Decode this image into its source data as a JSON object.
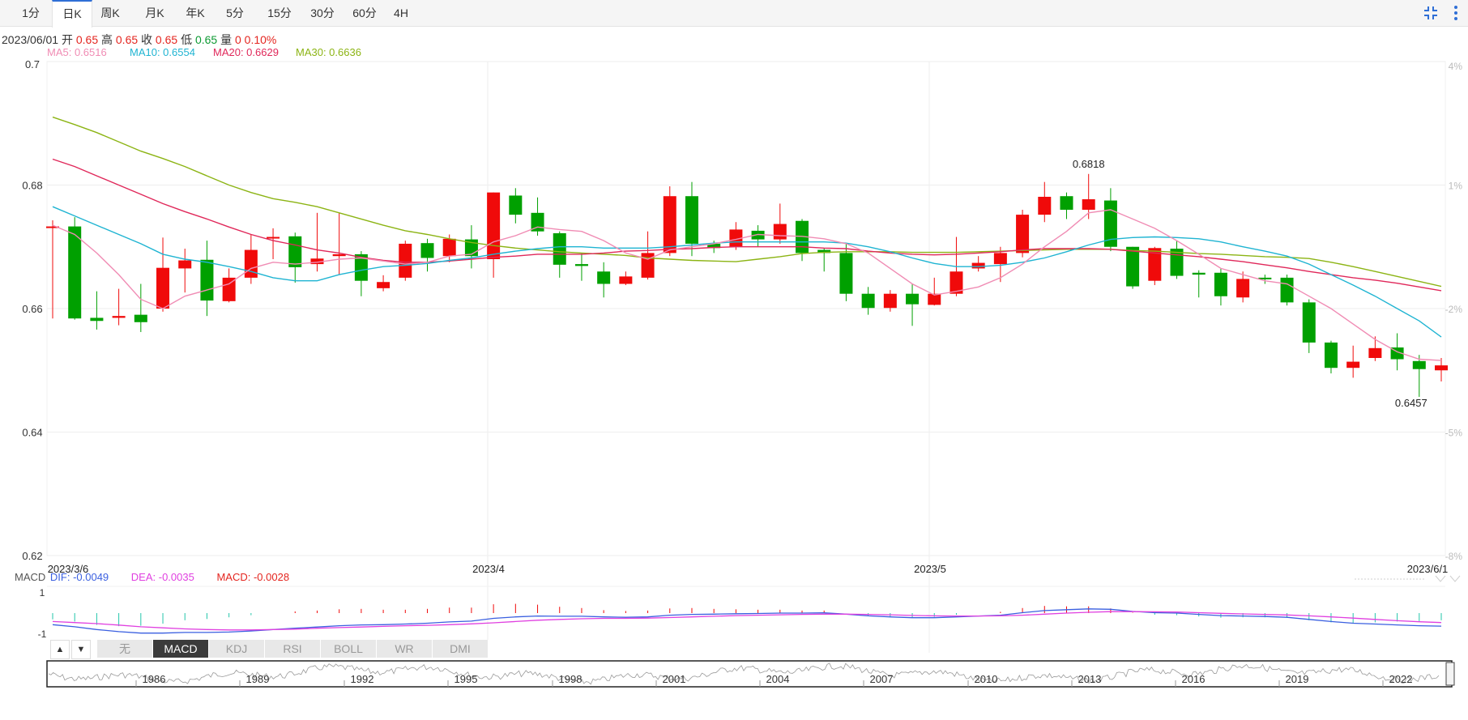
{
  "toolbar": {
    "tabs": [
      "1分",
      "日K",
      "周K",
      "月K",
      "年K",
      "5分",
      "15分",
      "30分",
      "60分",
      "4H"
    ],
    "active_tab": "日K",
    "icons": [
      "fullscreen-exit-icon",
      "more-menu-icon"
    ]
  },
  "ohlc_info": {
    "date": "2023/06/01",
    "open_label": "开",
    "open": "0.65",
    "high_label": "高",
    "high": "0.65",
    "close_label": "收",
    "close": "0.65",
    "low_label": "低",
    "low": "0.65",
    "volume_label": "量",
    "volume": "0",
    "change": "0.10%"
  },
  "ma_info": [
    {
      "label": "MA5: 0.6516",
      "color": "#f08cb4"
    },
    {
      "label": "MA10: 0.6554",
      "color": "#1fb4d2"
    },
    {
      "label": "MA20: 0.6629",
      "color": "#e0285a"
    },
    {
      "label": "MA30: 0.6636",
      "color": "#8cb414"
    }
  ],
  "macd_info": {
    "name": "MACD",
    "dif": {
      "label": "DIF: -0.0049",
      "color": "#3a5fe0"
    },
    "dea": {
      "label": "DEA: -0.0035",
      "color": "#e040e0"
    },
    "macd": {
      "label": "MACD: -0.0028",
      "color": "#e4251f"
    }
  },
  "indicator_tabs": [
    "无",
    "MACD",
    "KDJ",
    "RSI",
    "BOLL",
    "WR",
    "DMI"
  ],
  "active_indicator": "MACD",
  "indicator_arrows": [
    "▲",
    "▼"
  ],
  "colors": {
    "up": "#f00a0a",
    "down": "#00a000",
    "grid": "#eeeeee",
    "axis_text": "#333333",
    "pct_text": "#bbbbbb"
  },
  "chart_data": {
    "type": "candlestick",
    "y_ticks": [
      "0.7",
      "0.68",
      "0.66",
      "0.64",
      "0.62"
    ],
    "ylim": [
      0.62,
      0.7
    ],
    "pct_ticks": [
      "4%",
      "1%",
      "-2%",
      "-5%",
      "-8%"
    ],
    "x_labels": [
      "2023/3/6",
      "2023/4",
      "2023/5",
      "2023/6/1"
    ],
    "high_label": "0.6818",
    "low_label": "0.6457",
    "candles": [
      {
        "o": 0.6733,
        "h": 0.6743,
        "l": 0.6584,
        "c": 0.6733
      },
      {
        "o": 0.6733,
        "h": 0.6748,
        "l": 0.6582,
        "c": 0.6584
      },
      {
        "o": 0.6585,
        "h": 0.6628,
        "l": 0.6566,
        "c": 0.658
      },
      {
        "o": 0.6585,
        "h": 0.6632,
        "l": 0.6573,
        "c": 0.6588
      },
      {
        "o": 0.659,
        "h": 0.664,
        "l": 0.6562,
        "c": 0.6578
      },
      {
        "o": 0.66,
        "h": 0.6715,
        "l": 0.6595,
        "c": 0.6666
      },
      {
        "o": 0.6665,
        "h": 0.6697,
        "l": 0.6626,
        "c": 0.6678
      },
      {
        "o": 0.6679,
        "h": 0.671,
        "l": 0.6588,
        "c": 0.6613
      },
      {
        "o": 0.6612,
        "h": 0.6665,
        "l": 0.661,
        "c": 0.665
      },
      {
        "o": 0.665,
        "h": 0.672,
        "l": 0.664,
        "c": 0.6695
      },
      {
        "o": 0.6715,
        "h": 0.673,
        "l": 0.668,
        "c": 0.6716
      },
      {
        "o": 0.6717,
        "h": 0.6723,
        "l": 0.6642,
        "c": 0.6667
      },
      {
        "o": 0.6672,
        "h": 0.6755,
        "l": 0.666,
        "c": 0.6681
      },
      {
        "o": 0.6685,
        "h": 0.6755,
        "l": 0.6655,
        "c": 0.6688
      },
      {
        "o": 0.6688,
        "h": 0.6693,
        "l": 0.662,
        "c": 0.6645
      },
      {
        "o": 0.6633,
        "h": 0.6654,
        "l": 0.6628,
        "c": 0.6643
      },
      {
        "o": 0.665,
        "h": 0.671,
        "l": 0.6645,
        "c": 0.6705
      },
      {
        "o": 0.6706,
        "h": 0.6713,
        "l": 0.666,
        "c": 0.6682
      },
      {
        "o": 0.6685,
        "h": 0.672,
        "l": 0.6675,
        "c": 0.6713
      },
      {
        "o": 0.6712,
        "h": 0.6735,
        "l": 0.6665,
        "c": 0.6685
      },
      {
        "o": 0.668,
        "h": 0.6788,
        "l": 0.665,
        "c": 0.6788
      },
      {
        "o": 0.6783,
        "h": 0.6795,
        "l": 0.6738,
        "c": 0.6752
      },
      {
        "o": 0.6755,
        "h": 0.678,
        "l": 0.6718,
        "c": 0.6725
      },
      {
        "o": 0.6722,
        "h": 0.6725,
        "l": 0.665,
        "c": 0.6671
      },
      {
        "o": 0.6672,
        "h": 0.669,
        "l": 0.6645,
        "c": 0.6669
      },
      {
        "o": 0.666,
        "h": 0.6675,
        "l": 0.6618,
        "c": 0.664
      },
      {
        "o": 0.664,
        "h": 0.666,
        "l": 0.6638,
        "c": 0.6652
      },
      {
        "o": 0.665,
        "h": 0.6725,
        "l": 0.6647,
        "c": 0.669
      },
      {
        "o": 0.669,
        "h": 0.6798,
        "l": 0.6685,
        "c": 0.6782
      },
      {
        "o": 0.6782,
        "h": 0.6805,
        "l": 0.6685,
        "c": 0.6705
      },
      {
        "o": 0.6705,
        "h": 0.671,
        "l": 0.669,
        "c": 0.6698
      },
      {
        "o": 0.67,
        "h": 0.674,
        "l": 0.6695,
        "c": 0.6728
      },
      {
        "o": 0.6726,
        "h": 0.6735,
        "l": 0.67,
        "c": 0.6712
      },
      {
        "o": 0.6712,
        "h": 0.677,
        "l": 0.6705,
        "c": 0.6737
      },
      {
        "o": 0.6742,
        "h": 0.6745,
        "l": 0.6677,
        "c": 0.669
      },
      {
        "o": 0.6695,
        "h": 0.6698,
        "l": 0.666,
        "c": 0.669
      },
      {
        "o": 0.669,
        "h": 0.6705,
        "l": 0.6612,
        "c": 0.6624
      },
      {
        "o": 0.6624,
        "h": 0.6635,
        "l": 0.659,
        "c": 0.6601
      },
      {
        "o": 0.6601,
        "h": 0.663,
        "l": 0.6595,
        "c": 0.6624
      },
      {
        "o": 0.6624,
        "h": 0.664,
        "l": 0.6572,
        "c": 0.6607
      },
      {
        "o": 0.6606,
        "h": 0.665,
        "l": 0.6605,
        "c": 0.6624
      },
      {
        "o": 0.6624,
        "h": 0.6716,
        "l": 0.662,
        "c": 0.666
      },
      {
        "o": 0.6665,
        "h": 0.6685,
        "l": 0.666,
        "c": 0.6674
      },
      {
        "o": 0.6672,
        "h": 0.67,
        "l": 0.6643,
        "c": 0.669
      },
      {
        "o": 0.669,
        "h": 0.676,
        "l": 0.6683,
        "c": 0.6752
      },
      {
        "o": 0.6752,
        "h": 0.6805,
        "l": 0.674,
        "c": 0.6781
      },
      {
        "o": 0.6782,
        "h": 0.6788,
        "l": 0.6745,
        "c": 0.676
      },
      {
        "o": 0.676,
        "h": 0.6818,
        "l": 0.6745,
        "c": 0.6777
      },
      {
        "o": 0.6775,
        "h": 0.6795,
        "l": 0.6693,
        "c": 0.67
      },
      {
        "o": 0.67,
        "h": 0.67,
        "l": 0.6632,
        "c": 0.6636
      },
      {
        "o": 0.6645,
        "h": 0.67,
        "l": 0.6638,
        "c": 0.6698
      },
      {
        "o": 0.6697,
        "h": 0.671,
        "l": 0.6648,
        "c": 0.6653
      },
      {
        "o": 0.6658,
        "h": 0.6662,
        "l": 0.6618,
        "c": 0.6655
      },
      {
        "o": 0.6658,
        "h": 0.6665,
        "l": 0.6605,
        "c": 0.662
      },
      {
        "o": 0.6618,
        "h": 0.666,
        "l": 0.661,
        "c": 0.6648
      },
      {
        "o": 0.665,
        "h": 0.6655,
        "l": 0.664,
        "c": 0.6648
      },
      {
        "o": 0.665,
        "h": 0.6655,
        "l": 0.6605,
        "c": 0.661
      },
      {
        "o": 0.661,
        "h": 0.6615,
        "l": 0.6528,
        "c": 0.6545
      },
      {
        "o": 0.6545,
        "h": 0.6548,
        "l": 0.6495,
        "c": 0.6504
      },
      {
        "o": 0.6504,
        "h": 0.654,
        "l": 0.6488,
        "c": 0.6514
      },
      {
        "o": 0.652,
        "h": 0.6555,
        "l": 0.6515,
        "c": 0.6536
      },
      {
        "o": 0.6537,
        "h": 0.656,
        "l": 0.65,
        "c": 0.6518
      },
      {
        "o": 0.6515,
        "h": 0.6525,
        "l": 0.6457,
        "c": 0.6502
      },
      {
        "o": 0.65,
        "h": 0.652,
        "l": 0.6482,
        "c": 0.6508
      }
    ],
    "ma5": [
      0.6735,
      0.672,
      0.669,
      0.6655,
      0.6615,
      0.66,
      0.662,
      0.663,
      0.664,
      0.6665,
      0.6675,
      0.6672,
      0.6675,
      0.668,
      0.6682,
      0.6677,
      0.6672,
      0.6675,
      0.6685,
      0.6688,
      0.6708,
      0.6718,
      0.6732,
      0.6728,
      0.6725,
      0.671,
      0.669,
      0.668,
      0.6695,
      0.67,
      0.6705,
      0.6712,
      0.672,
      0.6718,
      0.6717,
      0.6713,
      0.6705,
      0.669,
      0.6665,
      0.664,
      0.6622,
      0.6628,
      0.6635,
      0.665,
      0.6672,
      0.67,
      0.6725,
      0.6755,
      0.676,
      0.6745,
      0.673,
      0.671,
      0.6688,
      0.6665,
      0.6655,
      0.6645,
      0.664,
      0.662,
      0.66,
      0.6575,
      0.655,
      0.653,
      0.6518,
      0.6516
    ],
    "ma10": [
      0.6765,
      0.675,
      0.6735,
      0.672,
      0.6705,
      0.6688,
      0.668,
      0.6675,
      0.6668,
      0.666,
      0.665,
      0.6645,
      0.6645,
      0.6655,
      0.6662,
      0.6668,
      0.667,
      0.6673,
      0.6678,
      0.6682,
      0.6688,
      0.6693,
      0.6697,
      0.67,
      0.67,
      0.6698,
      0.6698,
      0.6698,
      0.67,
      0.6703,
      0.6706,
      0.6708,
      0.6708,
      0.6708,
      0.6708,
      0.6708,
      0.6706,
      0.67,
      0.6692,
      0.6682,
      0.6673,
      0.6668,
      0.6668,
      0.667,
      0.6675,
      0.6682,
      0.6692,
      0.6703,
      0.6712,
      0.6715,
      0.6716,
      0.6715,
      0.6713,
      0.6708,
      0.67,
      0.6693,
      0.6685,
      0.6672,
      0.6655,
      0.6638,
      0.662,
      0.66,
      0.658,
      0.6554
    ],
    "ma20": [
      0.6842,
      0.683,
      0.6815,
      0.68,
      0.6785,
      0.677,
      0.6757,
      0.6745,
      0.6732,
      0.672,
      0.671,
      0.6703,
      0.6695,
      0.669,
      0.6683,
      0.6678,
      0.6675,
      0.6675,
      0.6677,
      0.668,
      0.6683,
      0.6685,
      0.6688,
      0.6688,
      0.6688,
      0.669,
      0.6693,
      0.6694,
      0.6696,
      0.6697,
      0.6699,
      0.67,
      0.67,
      0.67,
      0.67,
      0.6698,
      0.6697,
      0.6693,
      0.669,
      0.6688,
      0.6687,
      0.6688,
      0.669,
      0.6692,
      0.6695,
      0.6697,
      0.6697,
      0.6697,
      0.6696,
      0.6693,
      0.669,
      0.6687,
      0.6684,
      0.668,
      0.6676,
      0.6671,
      0.6666,
      0.666,
      0.6655,
      0.665,
      0.6646,
      0.6641,
      0.6635,
      0.6629
    ],
    "ma30": [
      0.691,
      0.6898,
      0.6885,
      0.687,
      0.6855,
      0.6843,
      0.683,
      0.6815,
      0.68,
      0.6788,
      0.6778,
      0.6772,
      0.6765,
      0.6755,
      0.6745,
      0.6735,
      0.6726,
      0.672,
      0.6713,
      0.6707,
      0.6702,
      0.6698,
      0.6695,
      0.6692,
      0.669,
      0.6688,
      0.6686,
      0.6682,
      0.668,
      0.6678,
      0.6677,
      0.6676,
      0.668,
      0.6684,
      0.6689,
      0.6691,
      0.6692,
      0.6692,
      0.6692,
      0.6691,
      0.6691,
      0.6691,
      0.6692,
      0.6693,
      0.6694,
      0.6695,
      0.6696,
      0.6696,
      0.6696,
      0.6694,
      0.6693,
      0.6691,
      0.6689,
      0.6688,
      0.6686,
      0.6684,
      0.6683,
      0.6681,
      0.6675,
      0.6668,
      0.666,
      0.6652,
      0.6644,
      0.6636
    ],
    "macd_ylabels": [
      "1",
      "-1"
    ],
    "dif": [
      -0.55,
      -0.65,
      -0.78,
      -0.88,
      -0.95,
      -0.95,
      -0.92,
      -0.92,
      -0.9,
      -0.85,
      -0.78,
      -0.72,
      -0.66,
      -0.6,
      -0.56,
      -0.55,
      -0.52,
      -0.48,
      -0.42,
      -0.38,
      -0.25,
      -0.18,
      -0.14,
      -0.15,
      -0.15,
      -0.18,
      -0.2,
      -0.18,
      -0.1,
      -0.06,
      -0.05,
      -0.03,
      -0.02,
      0.0,
      0.0,
      0.01,
      -0.05,
      -0.13,
      -0.18,
      -0.22,
      -0.22,
      -0.18,
      -0.14,
      -0.1,
      0.02,
      0.12,
      0.16,
      0.2,
      0.18,
      0.08,
      0.02,
      0.0,
      -0.06,
      -0.12,
      -0.14,
      -0.16,
      -0.2,
      -0.3,
      -0.4,
      -0.48,
      -0.52,
      -0.56,
      -0.6,
      -0.62
    ],
    "dea": [
      -0.4,
      -0.45,
      -0.5,
      -0.57,
      -0.65,
      -0.7,
      -0.75,
      -0.78,
      -0.8,
      -0.8,
      -0.78,
      -0.76,
      -0.72,
      -0.69,
      -0.66,
      -0.63,
      -0.6,
      -0.58,
      -0.55,
      -0.51,
      -0.46,
      -0.4,
      -0.34,
      -0.3,
      -0.27,
      -0.25,
      -0.25,
      -0.24,
      -0.21,
      -0.18,
      -0.15,
      -0.12,
      -0.1,
      -0.08,
      -0.06,
      -0.05,
      -0.05,
      -0.06,
      -0.08,
      -0.11,
      -0.13,
      -0.14,
      -0.14,
      -0.13,
      -0.1,
      -0.05,
      0.0,
      0.04,
      0.07,
      0.07,
      0.06,
      0.05,
      0.02,
      -0.01,
      -0.04,
      -0.06,
      -0.09,
      -0.13,
      -0.18,
      -0.24,
      -0.3,
      -0.36,
      -0.41,
      -0.45
    ],
    "navigator_years": [
      "1986",
      "1989",
      "1992",
      "1995",
      "1998",
      "2001",
      "2004",
      "2007",
      "2010",
      "2013",
      "2016",
      "2019",
      "2022"
    ]
  }
}
